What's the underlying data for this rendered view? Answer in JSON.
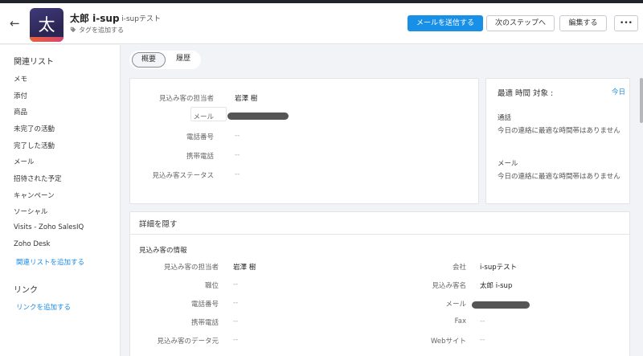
{
  "header": {
    "avatar_char": "太",
    "lead_name": "太郎 i-sup",
    "company": "- i-supテスト",
    "tag_label": "タグを追加する",
    "buttons": {
      "send_email": "メールを送信する",
      "next_step": "次のステップへ",
      "edit": "編集する",
      "more": "•••"
    }
  },
  "sidebar": {
    "related_title": "関連リスト",
    "items": [
      "メモ",
      "添付",
      "商品",
      "未完了の活動",
      "完了した活動",
      "メール",
      "招待された予定",
      "キャンペーン",
      "ソーシャル",
      "Visits - Zoho SalesIQ",
      "Zoho Desk"
    ],
    "add_related": "関連リストを追加する",
    "links_title": "リンク",
    "add_link": "リンクを追加する"
  },
  "tabs": [
    "概要",
    "履歴"
  ],
  "summary": {
    "owner_label": "見込み客の担当者",
    "owner_value": "岩澤 樹",
    "email_label": "メール",
    "phone_label": "電話番号",
    "mobile_label": "携帯電話",
    "status_label": "見込み客ステータス",
    "empty": "--"
  },
  "best_time": {
    "title": "最適 時間 対象 :",
    "today": "今日",
    "call_label": "通話",
    "call_text": "今日の連絡に最適な時間帯はありません",
    "email_label": "メール",
    "email_text": "今日の連絡に最適な時間帯はありません"
  },
  "details": {
    "hide_label": "詳細を隠す",
    "section_title": "見込み客の情報",
    "left": [
      {
        "label": "見込み客の担当者",
        "value": "岩澤 樹"
      },
      {
        "label": "職位",
        "value": "--"
      },
      {
        "label": "電話番号",
        "value": "--"
      },
      {
        "label": "携帯電話",
        "value": "--"
      },
      {
        "label": "見込み客のデータ元",
        "value": "--"
      }
    ],
    "right": [
      {
        "label": "会社",
        "value": "i-supテスト"
      },
      {
        "label": "見込み客名",
        "value": "太郎 i-sup"
      },
      {
        "label": "メール",
        "value": ""
      },
      {
        "label": "Fax",
        "value": "--"
      },
      {
        "label": "Webサイト",
        "value": "--"
      }
    ]
  },
  "colors": {
    "primary": "#1890e8",
    "link": "#1a8be8",
    "avatar_bg": "#2b2553",
    "avatar_accent": "#e9623a"
  }
}
